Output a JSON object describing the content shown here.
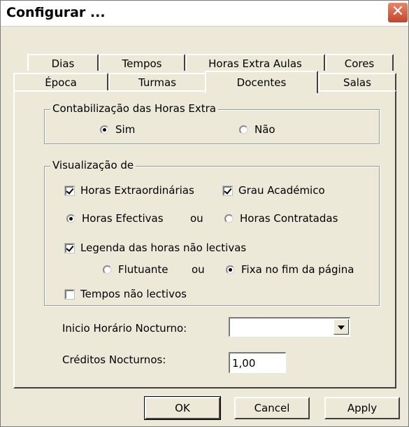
{
  "window": {
    "title": "Configurar ...",
    "close_glyph": "✕"
  },
  "tabs": {
    "row1": [
      "Dias",
      "Tempos",
      "Horas Extra Aulas",
      "Cores"
    ],
    "row2": [
      "Época",
      "Turmas",
      "Docentes",
      "Salas"
    ],
    "active": "Docentes"
  },
  "contabilizacao": {
    "legend": "Contabilização das Horas Extra",
    "options": [
      {
        "label": "Sim",
        "selected": true
      },
      {
        "label": "Não",
        "selected": false
      }
    ]
  },
  "visualizacao": {
    "legend": "Visualização de",
    "horas_extra": {
      "label": "Horas Extraordinárias",
      "checked": true
    },
    "grau": {
      "label": "Grau Académico",
      "checked": true
    },
    "horas_efectivas": {
      "label": "Horas Efectivas",
      "selected": true
    },
    "ou1": "ou",
    "horas_contratadas": {
      "label": "Horas Contratadas",
      "selected": false
    },
    "legenda": {
      "label": "Legenda das horas não lectivas",
      "checked": true
    },
    "flutuante": {
      "label": "Flutuante",
      "selected": false
    },
    "ou2": "ou",
    "fixa": {
      "label": "Fixa no fim da página",
      "selected": true
    },
    "tempos": {
      "label": "Tempos não lectivos",
      "checked": false
    }
  },
  "inicio": {
    "label": "Inicio Horário Nocturno:",
    "value": ""
  },
  "creditos": {
    "label": "Créditos Nocturnos:",
    "value": "1,00"
  },
  "buttons": {
    "ok": "OK",
    "cancel": "Cancel",
    "apply": "Apply"
  }
}
